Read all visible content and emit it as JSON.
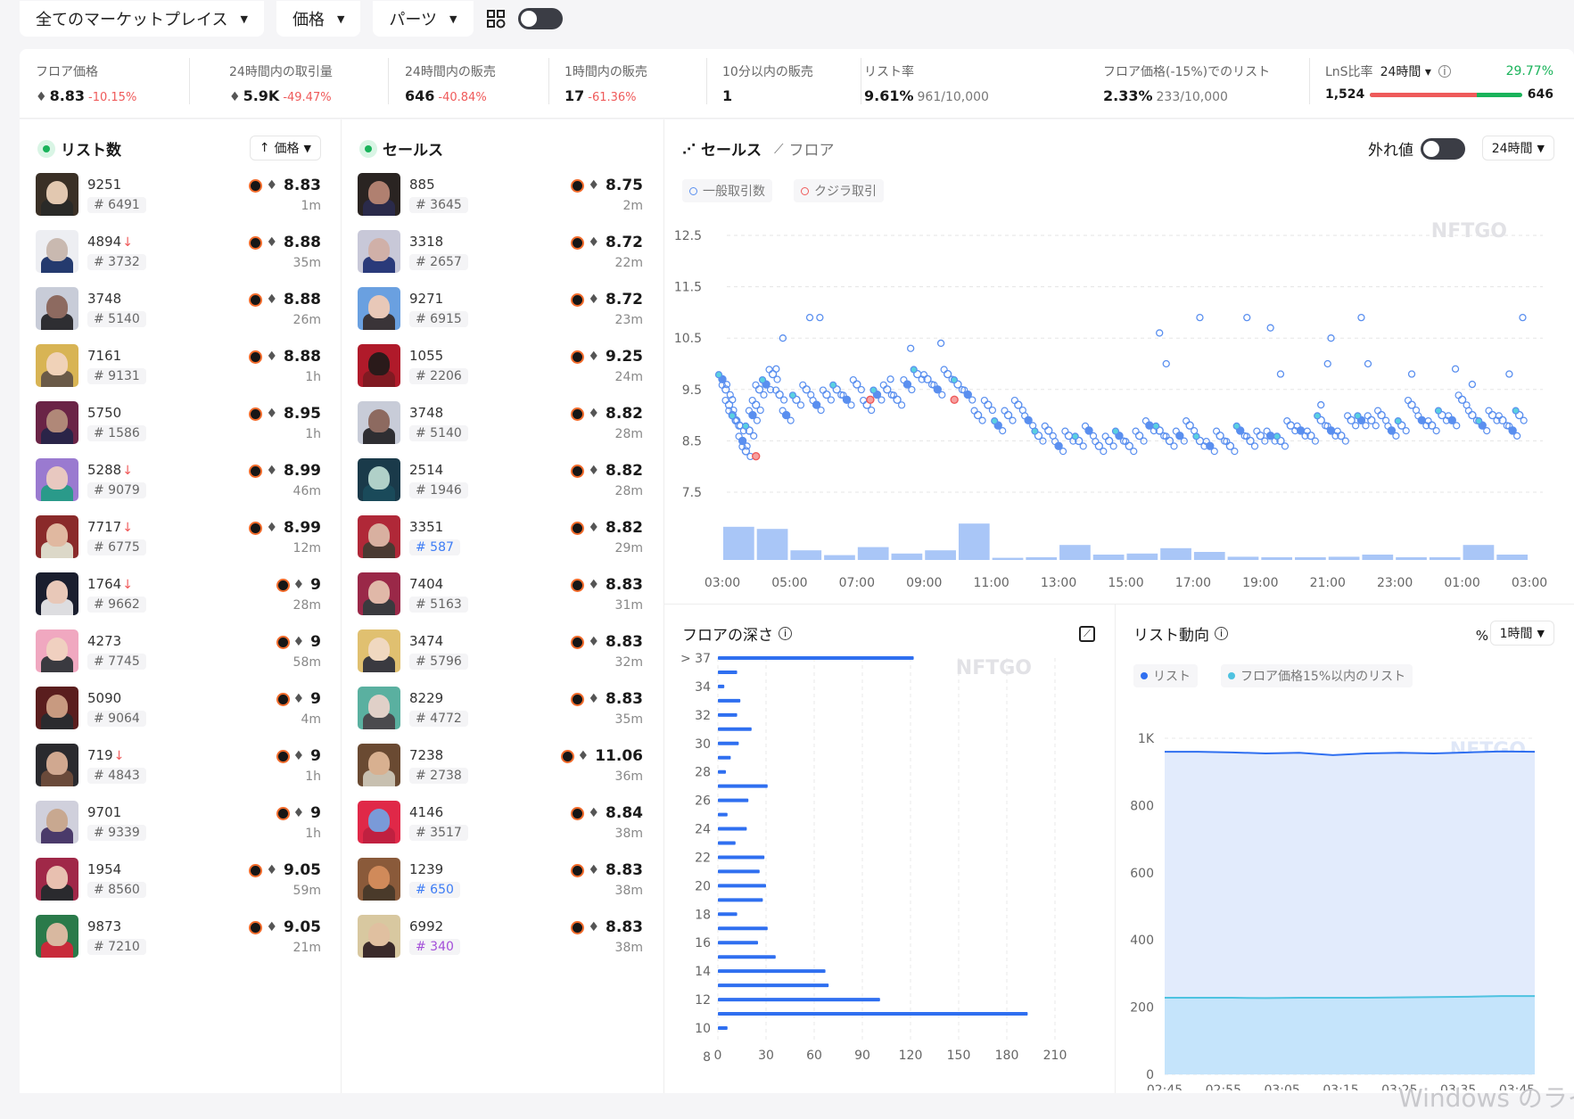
{
  "filters": [
    {
      "label": "全てのマーケットプレイス"
    },
    {
      "label": "価格"
    },
    {
      "label": "パーツ"
    }
  ],
  "stats": {
    "floor": {
      "label": "フロア価格",
      "value": "8.83",
      "change": "-10.15%"
    },
    "volume": {
      "label": "24時間内の取引量",
      "value": "5.9K",
      "change": "-49.47%"
    },
    "sales24": {
      "label": "24時間内の販売",
      "value": "646",
      "change": "-40.84%"
    },
    "sales1h": {
      "label": "1時間内の販売",
      "value": "17",
      "change": "-61.36%"
    },
    "sales10m": {
      "label": "10分以内の販売",
      "value": "1"
    },
    "listrate": {
      "label": "リスト率",
      "value": "9.61%",
      "sub": "961/10,000"
    },
    "floor15": {
      "label": "フロア価格(-15%)でのリスト",
      "value": "2.33%",
      "sub": "233/10,000"
    },
    "lns": {
      "label": "LnS比率",
      "period": "24時間",
      "pct": "29.77%",
      "left": "1,524",
      "right": "646",
      "ratio_red": 0.7
    }
  },
  "listings": {
    "title": "リスト数",
    "sort": "価格",
    "items": [
      {
        "name": "9251",
        "id": "# 6491",
        "price": "8.83",
        "time": "1m",
        "drop": false,
        "blur": false,
        "c1": "#3a3026",
        "c2": "#e2c8b0",
        "c3": "#2a2a28"
      },
      {
        "name": "4894",
        "id": "# 3732",
        "price": "8.88",
        "time": "35m",
        "drop": true,
        "blur": false,
        "c1": "#edeef2",
        "c2": "#c9b9b0",
        "c3": "#243a6e"
      },
      {
        "name": "3748",
        "id": "# 5140",
        "price": "8.88",
        "time": "26m",
        "drop": false,
        "blur": false,
        "c1": "#c8ccd8",
        "c2": "#8d6a60",
        "c3": "#2e2e32"
      },
      {
        "name": "7161",
        "id": "# 9131",
        "price": "8.88",
        "time": "1h",
        "drop": false,
        "blur": false,
        "c1": "#d8b454",
        "c2": "#f0d2b8",
        "c3": "#6a5a48"
      },
      {
        "name": "5750",
        "id": "# 1586",
        "price": "8.95",
        "time": "1h",
        "drop": false,
        "blur": false,
        "c1": "#6a2446",
        "c2": "#b08878",
        "c3": "#2a2448"
      },
      {
        "name": "5288",
        "id": "# 9079",
        "price": "8.99",
        "time": "46m",
        "drop": true,
        "blur": false,
        "c1": "#9a7ad0",
        "c2": "#e8c8c0",
        "c3": "#2a9a8a"
      },
      {
        "name": "7717",
        "id": "# 6775",
        "price": "8.99",
        "time": "12m",
        "drop": true,
        "blur": false,
        "c1": "#8a2a2a",
        "c2": "#e0b8a0",
        "c3": "#dcd8c8"
      },
      {
        "name": "1764",
        "id": "# 9662",
        "price": "9",
        "time": "28m",
        "drop": true,
        "blur": true,
        "c1": "#1a1e2e",
        "c2": "#e8c8b8",
        "c3": "#dddde0"
      },
      {
        "name": "4273",
        "id": "# 7745",
        "price": "9",
        "time": "58m",
        "drop": false,
        "blur": true,
        "c1": "#f0a8c0",
        "c2": "#f0d0c0",
        "c3": "#3a3a40"
      },
      {
        "name": "5090",
        "id": "# 9064",
        "price": "9",
        "time": "4m",
        "drop": false,
        "blur": true,
        "c1": "#5a1e1e",
        "c2": "#c89a80",
        "c3": "#2a2a2e"
      },
      {
        "name": "719",
        "id": "# 4843",
        "price": "9",
        "time": "1h",
        "drop": true,
        "blur": true,
        "c1": "#2a2a2e",
        "c2": "#d0a890",
        "c3": "#6a4a3a"
      },
      {
        "name": "9701",
        "id": "# 9339",
        "price": "9",
        "time": "1h",
        "drop": false,
        "blur": true,
        "c1": "#d0d0dc",
        "c2": "#c8a890",
        "c3": "#4a3a6a"
      },
      {
        "name": "1954",
        "id": "# 8560",
        "price": "9.05",
        "time": "59m",
        "drop": false,
        "blur": false,
        "c1": "#a02848",
        "c2": "#e8c0b0",
        "c3": "#2a2a2e"
      },
      {
        "name": "9873",
        "id": "# 7210",
        "price": "9.05",
        "time": "21m",
        "drop": false,
        "blur": false,
        "c1": "#2a7a4a",
        "c2": "#d8b8a0",
        "c3": "#c82a3a"
      }
    ]
  },
  "sales": {
    "title": "セールス",
    "items": [
      {
        "name": "885",
        "id": "# 3645",
        "price": "8.75",
        "time": "2m",
        "tc": "",
        "c1": "#2a2422",
        "c2": "#b08070",
        "c3": "#2a2a4a"
      },
      {
        "name": "3318",
        "id": "# 2657",
        "price": "8.72",
        "time": "22m",
        "tc": "",
        "c1": "#c8c8d8",
        "c2": "#d0b0a8",
        "c3": "#2a3a7a"
      },
      {
        "name": "9271",
        "id": "# 6915",
        "price": "8.72",
        "time": "23m",
        "tc": "",
        "c1": "#6aa0e0",
        "c2": "#e8c8b8",
        "c3": "#3a3438"
      },
      {
        "name": "1055",
        "id": "# 2206",
        "price": "9.25",
        "time": "24m",
        "tc": "",
        "c1": "#b01a2a",
        "c2": "#2a1a1a",
        "c3": "#801a22"
      },
      {
        "name": "3748",
        "id": "# 5140",
        "price": "8.82",
        "time": "28m",
        "tc": "",
        "c1": "#c8ccd8",
        "c2": "#8d6a60",
        "c3": "#2e2e32"
      },
      {
        "name": "2514",
        "id": "# 1946",
        "price": "8.82",
        "time": "28m",
        "tc": "",
        "c1": "#1a3a4a",
        "c2": "#b0d0c8",
        "c3": "#1a4a5a"
      },
      {
        "name": "3351",
        "id": "# 587",
        "price": "8.82",
        "time": "29m",
        "tc": "blu",
        "c1": "#b02838",
        "c2": "#d8b0a0",
        "c3": "#4a3a32"
      },
      {
        "name": "7404",
        "id": "# 5163",
        "price": "8.83",
        "time": "31m",
        "tc": "",
        "c1": "#9a2848",
        "c2": "#e0b8a8",
        "c3": "#3a3a3e"
      },
      {
        "name": "3474",
        "id": "# 5796",
        "price": "8.83",
        "time": "32m",
        "tc": "",
        "c1": "#e0c070",
        "c2": "#f0d8c0",
        "c3": "#3a3a40"
      },
      {
        "name": "8229",
        "id": "# 4772",
        "price": "8.83",
        "time": "35m",
        "tc": "",
        "c1": "#5ab0a0",
        "c2": "#e0d0c8",
        "c3": "#4a4a4e"
      },
      {
        "name": "7238",
        "id": "# 2738",
        "price": "11.06",
        "time": "36m",
        "tc": "",
        "c1": "#6a4a32",
        "c2": "#d8b090",
        "c3": "#c8c0b0"
      },
      {
        "name": "4146",
        "id": "# 3517",
        "price": "8.84",
        "time": "38m",
        "tc": "",
        "c1": "#e02848",
        "c2": "#7a9ad8",
        "c3": "#c02040"
      },
      {
        "name": "1239",
        "id": "# 650",
        "price": "8.83",
        "time": "38m",
        "tc": "blu",
        "c1": "#8a5a3a",
        "c2": "#d08a5a",
        "c3": "#4a3a2a"
      },
      {
        "name": "6992",
        "id": "# 340",
        "price": "8.83",
        "time": "38m",
        "tc": "pur",
        "c1": "#d8c8a0",
        "c2": "#e0c0a0",
        "c3": "#3a2a2a"
      }
    ]
  },
  "scatter": {
    "tab_sales": "セールス",
    "tab_floor": "フロア",
    "outlier_label": "外れ値",
    "period": "24時間",
    "legend_normal": "一般取引数",
    "legend_whale": "クジラ取引",
    "watermark": "NFTGO",
    "colors": {
      "normal": "#5a8fef",
      "whale": "#ef5a5a",
      "bar": "#a9c6f7"
    },
    "chart_data": {
      "type": "scatter",
      "yticks": [
        "12.5",
        "11.5",
        "10.5",
        "9.5",
        "8.5",
        "7.5"
      ],
      "ylim": [
        7.5,
        12.5
      ],
      "xticks": [
        "03:00",
        "05:00",
        "07:00",
        "09:00",
        "11:00",
        "13:00",
        "15:00",
        "17:00",
        "19:00",
        "21:00",
        "23:00",
        "01:00",
        "03:00"
      ],
      "xlim": [
        0,
        24
      ],
      "bar_volumes": [
        62,
        58,
        18,
        9,
        24,
        12,
        18,
        68,
        4,
        5,
        28,
        10,
        12,
        22,
        15,
        6,
        5,
        5,
        6,
        10,
        5,
        5,
        28,
        10
      ],
      "cluster_points": [
        [
          0.0,
          9.7
        ],
        [
          0.1,
          9.5
        ],
        [
          0.2,
          9.2
        ],
        [
          0.3,
          9.0
        ],
        [
          0.4,
          8.9
        ],
        [
          0.5,
          8.8
        ],
        [
          0.6,
          8.5
        ],
        [
          0.7,
          8.3
        ],
        [
          0.8,
          8.7
        ],
        [
          0.9,
          9.0
        ],
        [
          1.0,
          9.2
        ],
        [
          1.1,
          9.5
        ],
        [
          1.3,
          9.6
        ],
        [
          1.5,
          9.8
        ],
        [
          1.7,
          9.4
        ],
        [
          1.9,
          9.0
        ],
        [
          2.2,
          9.3
        ],
        [
          2.5,
          9.5
        ],
        [
          2.8,
          9.2
        ],
        [
          3.1,
          9.4
        ],
        [
          3.4,
          9.5
        ],
        [
          3.7,
          9.3
        ],
        [
          4.0,
          9.6
        ],
        [
          4.3,
          9.2
        ],
        [
          4.6,
          9.4
        ],
        [
          4.9,
          9.5
        ],
        [
          5.2,
          9.3
        ],
        [
          5.5,
          9.6
        ],
        [
          5.8,
          9.8
        ],
        [
          6.1,
          9.7
        ],
        [
          6.4,
          9.5
        ],
        [
          6.7,
          9.8
        ],
        [
          7.0,
          9.6
        ],
        [
          7.3,
          9.4
        ],
        [
          7.6,
          9.0
        ],
        [
          7.9,
          9.2
        ],
        [
          8.2,
          8.8
        ],
        [
          8.5,
          9.0
        ],
        [
          8.8,
          9.2
        ],
        [
          9.1,
          8.9
        ],
        [
          9.4,
          8.6
        ],
        [
          9.7,
          8.7
        ],
        [
          10.0,
          8.4
        ],
        [
          10.3,
          8.6
        ],
        [
          10.6,
          8.5
        ],
        [
          10.9,
          8.7
        ],
        [
          11.2,
          8.4
        ],
        [
          11.5,
          8.5
        ],
        [
          11.8,
          8.6
        ],
        [
          12.1,
          8.4
        ],
        [
          12.4,
          8.6
        ],
        [
          12.7,
          8.8
        ],
        [
          13.0,
          8.7
        ],
        [
          13.3,
          8.5
        ],
        [
          13.6,
          8.6
        ],
        [
          13.9,
          8.8
        ],
        [
          14.2,
          8.5
        ],
        [
          14.5,
          8.4
        ],
        [
          14.8,
          8.6
        ],
        [
          15.1,
          8.4
        ],
        [
          15.4,
          8.7
        ],
        [
          15.7,
          8.5
        ],
        [
          16.0,
          8.6
        ],
        [
          16.3,
          8.6
        ],
        [
          16.6,
          8.5
        ],
        [
          16.9,
          8.8
        ],
        [
          17.2,
          8.7
        ],
        [
          17.5,
          8.6
        ],
        [
          17.8,
          8.9
        ],
        [
          18.1,
          8.7
        ],
        [
          18.4,
          8.6
        ],
        [
          18.7,
          8.9
        ],
        [
          19.0,
          8.9
        ],
        [
          19.3,
          8.9
        ],
        [
          19.6,
          9.0
        ],
        [
          19.9,
          8.7
        ],
        [
          20.2,
          8.8
        ],
        [
          20.5,
          9.2
        ],
        [
          20.8,
          8.9
        ],
        [
          21.1,
          8.8
        ],
        [
          21.4,
          9.0
        ],
        [
          21.7,
          8.9
        ],
        [
          22.0,
          9.3
        ],
        [
          22.3,
          9.0
        ],
        [
          22.6,
          8.8
        ],
        [
          22.9,
          9.0
        ],
        [
          23.2,
          8.9
        ],
        [
          23.5,
          8.7
        ],
        [
          23.7,
          9.0
        ]
      ],
      "outliers": [
        [
          0.3,
          9.3
        ],
        [
          2.6,
          10.9
        ],
        [
          2.9,
          10.9
        ],
        [
          1.8,
          10.5
        ],
        [
          1.6,
          9.9
        ],
        [
          5.6,
          10.3
        ],
        [
          6.5,
          10.4
        ],
        [
          5.0,
          9.7
        ],
        [
          13.0,
          10.6
        ],
        [
          14.2,
          10.9
        ],
        [
          15.6,
          10.9
        ],
        [
          16.3,
          10.7
        ],
        [
          19.0,
          10.9
        ],
        [
          18.0,
          10.0
        ],
        [
          18.1,
          10.5
        ],
        [
          19.2,
          10.0
        ],
        [
          16.6,
          9.8
        ],
        [
          20.5,
          9.8
        ],
        [
          23.8,
          10.9
        ],
        [
          23.4,
          9.8
        ],
        [
          13.2,
          10.0
        ],
        [
          17.8,
          9.2
        ],
        [
          21.8,
          9.9
        ],
        [
          22.3,
          9.6
        ]
      ],
      "whale_points": [
        [
          1.0,
          8.2
        ],
        [
          4.4,
          9.3
        ],
        [
          6.9,
          9.3
        ]
      ]
    }
  },
  "depth": {
    "title": "フロアの深さ",
    "watermark": "NFTGO",
    "chart_data": {
      "type": "bar",
      "categories": [
        "> 37",
        "34",
        "32",
        "30",
        "28",
        "26",
        "24",
        "22",
        "20",
        "18",
        "16",
        "14",
        "12",
        "10",
        "8"
      ],
      "ylabels": [
        "> 37",
        "",
        "34",
        "",
        "32",
        "",
        "30",
        "",
        "28",
        "",
        "26",
        "",
        "24",
        "",
        "22",
        "",
        "20",
        "",
        "18",
        "",
        "16",
        "",
        "14",
        "",
        "12",
        "",
        "10",
        "",
        "8"
      ],
      "values": [
        122,
        12,
        4,
        14,
        12,
        21,
        13,
        8,
        5,
        31,
        19,
        6,
        18,
        11,
        29,
        26,
        30,
        28,
        12,
        31,
        25,
        36,
        67,
        69,
        101,
        193,
        6
      ],
      "xticks": [
        "0",
        "30",
        "60",
        "90",
        "120",
        "150",
        "180",
        "210"
      ],
      "xlim": [
        0,
        210
      ]
    }
  },
  "trend": {
    "title": "リスト動向",
    "pct_label": "%",
    "period": "1時間",
    "legend_list": "リスト",
    "legend_floor15": "フロア価格15%以内のリスト",
    "watermark": "NFTGO",
    "colors": {
      "list": "#2f6ff0",
      "floor15": "#4ec2e0"
    },
    "chart_data": {
      "type": "area",
      "yticks": [
        "1K",
        "800",
        "600",
        "400",
        "200",
        "0"
      ],
      "ylim": [
        0,
        1000
      ],
      "xticks": [
        "02:45",
        "02:55",
        "03:05",
        "03:15",
        "03:25",
        "03:35",
        "03:45"
      ],
      "series": [
        {
          "name": "リスト",
          "values": [
            960,
            960,
            958,
            955,
            957,
            950,
            955,
            957,
            955,
            958,
            961,
            960
          ]
        },
        {
          "name": "フロア価格15%以内のリスト",
          "values": [
            228,
            228,
            228,
            227,
            228,
            228,
            228,
            229,
            230,
            231,
            233,
            233
          ]
        }
      ]
    }
  },
  "watermark_os": "Windows のライ"
}
